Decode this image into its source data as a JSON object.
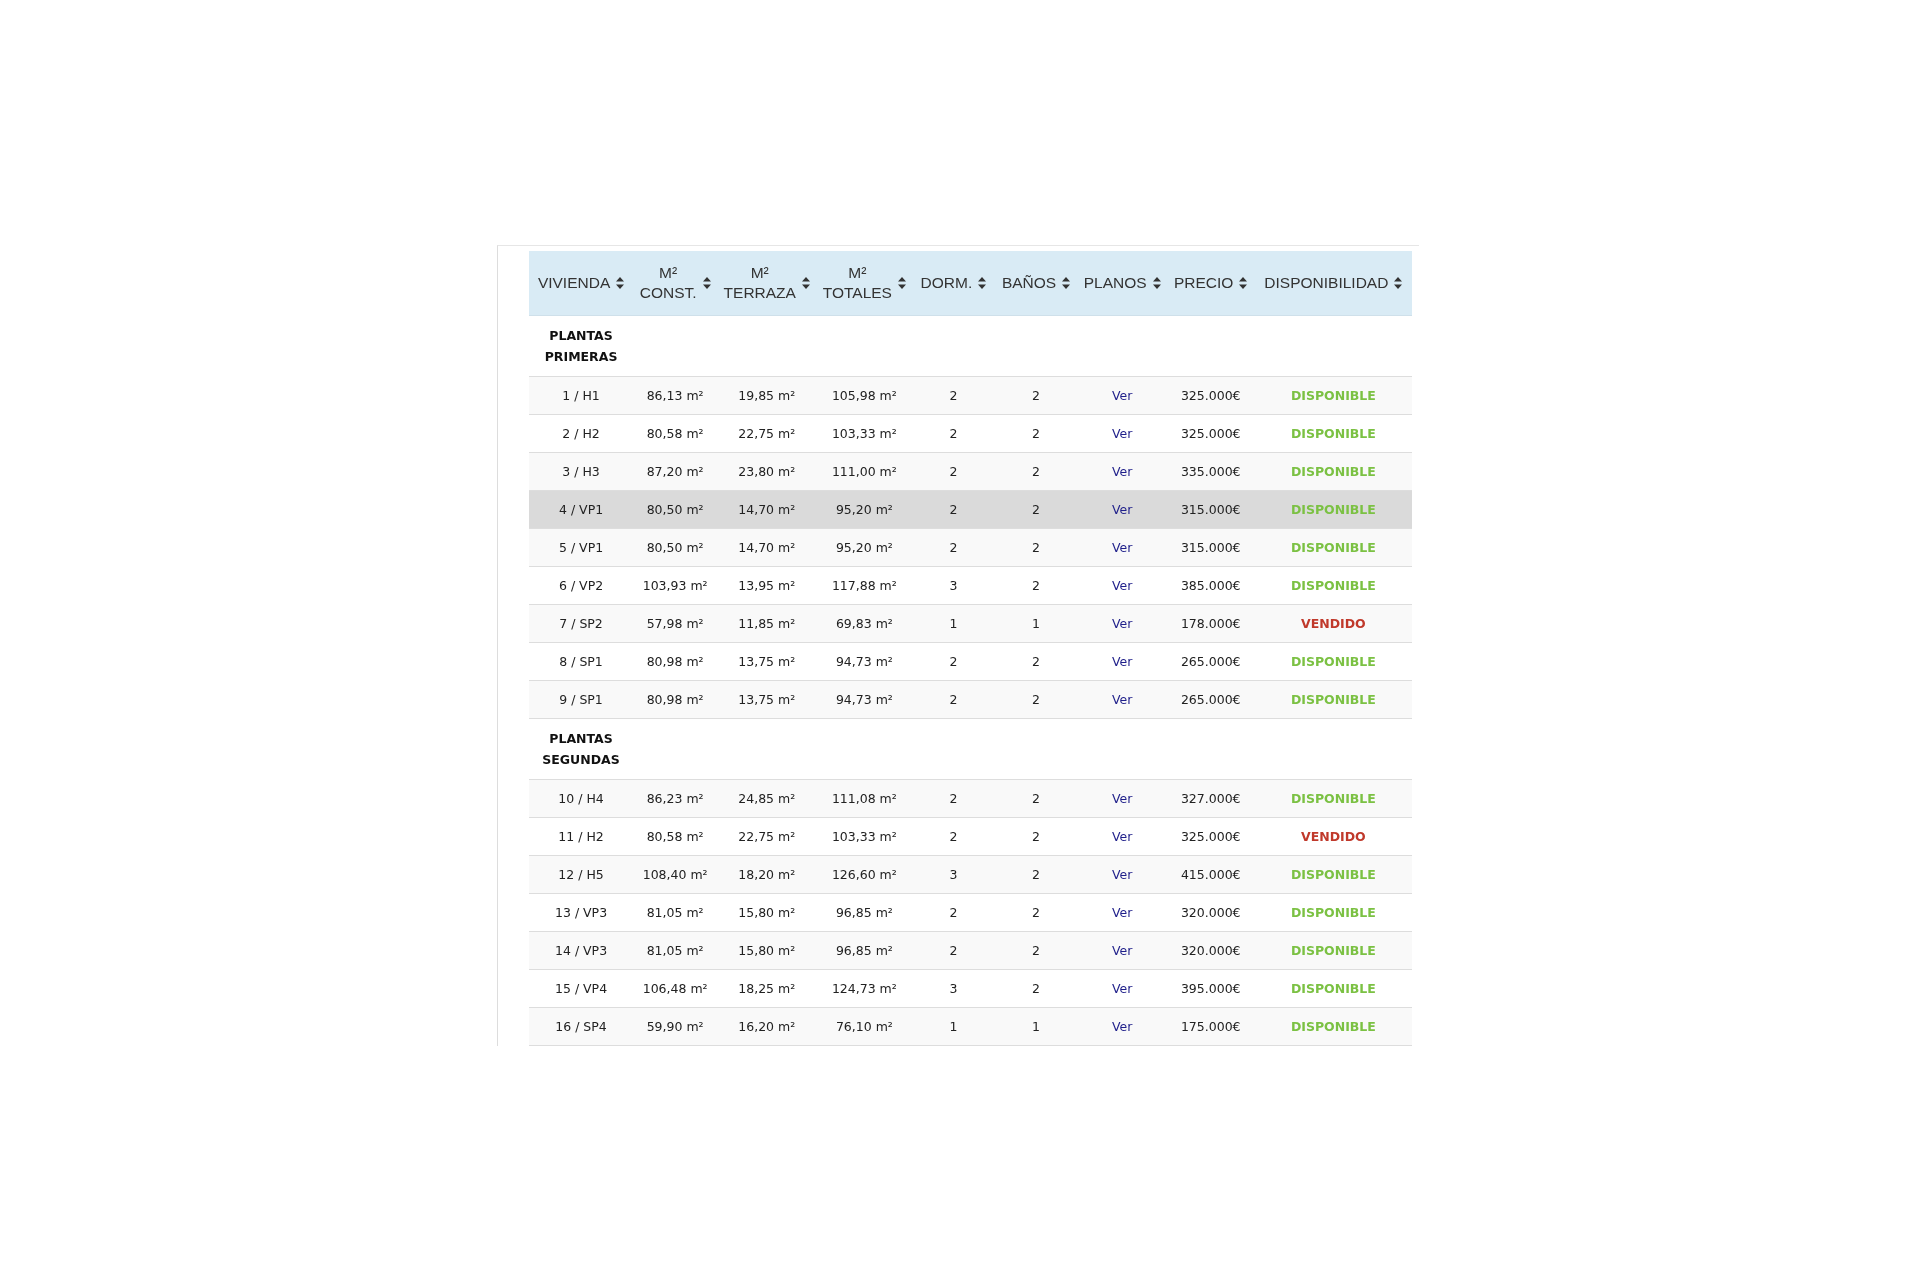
{
  "columns": [
    {
      "label": "VIVIENDA"
    },
    {
      "label": "M² CONST."
    },
    {
      "label": "M² TERRAZA"
    },
    {
      "label": "M² TOTALES"
    },
    {
      "label": "DORM."
    },
    {
      "label": "BAÑOS"
    },
    {
      "label": "PLANOS"
    },
    {
      "label": "PRECIO"
    },
    {
      "label": "DISPONIBILIDAD"
    }
  ],
  "sections": [
    {
      "title": "PLANTAS PRIMERAS",
      "rows": [
        {
          "vivienda": "1 / H1",
          "m2_const": "86,13 m²",
          "m2_terraza": "19,85 m²",
          "m2_totales": "105,98 m²",
          "dorm": "2",
          "banos": "2",
          "planos": "Ver",
          "precio": "325.000€",
          "status": "DISPONIBLE",
          "kind": "available",
          "hovered": false
        },
        {
          "vivienda": "2 / H2",
          "m2_const": "80,58 m²",
          "m2_terraza": "22,75 m²",
          "m2_totales": "103,33 m²",
          "dorm": "2",
          "banos": "2",
          "planos": "Ver",
          "precio": "325.000€",
          "status": "DISPONIBLE",
          "kind": "available",
          "hovered": false
        },
        {
          "vivienda": "3 / H3",
          "m2_const": "87,20 m²",
          "m2_terraza": "23,80 m²",
          "m2_totales": "111,00 m²",
          "dorm": "2",
          "banos": "2",
          "planos": "Ver",
          "precio": "335.000€",
          "status": "DISPONIBLE",
          "kind": "available",
          "hovered": false
        },
        {
          "vivienda": "4 / VP1",
          "m2_const": "80,50 m²",
          "m2_terraza": "14,70 m²",
          "m2_totales": "95,20 m²",
          "dorm": "2",
          "banos": "2",
          "planos": "Ver",
          "precio": "315.000€",
          "status": "DISPONIBLE",
          "kind": "available",
          "hovered": true
        },
        {
          "vivienda": "5 / VP1",
          "m2_const": "80,50 m²",
          "m2_terraza": "14,70 m²",
          "m2_totales": "95,20 m²",
          "dorm": "2",
          "banos": "2",
          "planos": "Ver",
          "precio": "315.000€",
          "status": "DISPONIBLE",
          "kind": "available",
          "hovered": false
        },
        {
          "vivienda": "6 / VP2",
          "m2_const": "103,93 m²",
          "m2_terraza": "13,95 m²",
          "m2_totales": "117,88 m²",
          "dorm": "3",
          "banos": "2",
          "planos": "Ver",
          "precio": "385.000€",
          "status": "DISPONIBLE",
          "kind": "available",
          "hovered": false
        },
        {
          "vivienda": "7 / SP2",
          "m2_const": "57,98 m²",
          "m2_terraza": "11,85 m²",
          "m2_totales": "69,83 m²",
          "dorm": "1",
          "banos": "1",
          "planos": "Ver",
          "precio": "178.000€",
          "status": "VENDIDO",
          "kind": "sold",
          "hovered": false
        },
        {
          "vivienda": "8 / SP1",
          "m2_const": "80,98 m²",
          "m2_terraza": "13,75 m²",
          "m2_totales": "94,73 m²",
          "dorm": "2",
          "banos": "2",
          "planos": "Ver",
          "precio": "265.000€",
          "status": "DISPONIBLE",
          "kind": "available",
          "hovered": false
        },
        {
          "vivienda": "9 / SP1",
          "m2_const": "80,98 m²",
          "m2_terraza": "13,75 m²",
          "m2_totales": "94,73 m²",
          "dorm": "2",
          "banos": "2",
          "planos": "Ver",
          "precio": "265.000€",
          "status": "DISPONIBLE",
          "kind": "available",
          "hovered": false
        }
      ]
    },
    {
      "title": "PLANTAS SEGUNDAS",
      "rows": [
        {
          "vivienda": "10 / H4",
          "m2_const": "86,23 m²",
          "m2_terraza": "24,85 m²",
          "m2_totales": "111,08 m²",
          "dorm": "2",
          "banos": "2",
          "planos": "Ver",
          "precio": "327.000€",
          "status": "DISPONIBLE",
          "kind": "available",
          "hovered": false
        },
        {
          "vivienda": "11 / H2",
          "m2_const": "80,58 m²",
          "m2_terraza": "22,75 m²",
          "m2_totales": "103,33 m²",
          "dorm": "2",
          "banos": "2",
          "planos": "Ver",
          "precio": "325.000€",
          "status": "VENDIDO",
          "kind": "sold",
          "hovered": false
        },
        {
          "vivienda": "12 / H5",
          "m2_const": "108,40 m²",
          "m2_terraza": "18,20 m²",
          "m2_totales": "126,60 m²",
          "dorm": "3",
          "banos": "2",
          "planos": "Ver",
          "precio": "415.000€",
          "status": "DISPONIBLE",
          "kind": "available",
          "hovered": false
        },
        {
          "vivienda": "13 / VP3",
          "m2_const": "81,05 m²",
          "m2_terraza": "15,80 m²",
          "m2_totales": "96,85 m²",
          "dorm": "2",
          "banos": "2",
          "planos": "Ver",
          "precio": "320.000€",
          "status": "DISPONIBLE",
          "kind": "available",
          "hovered": false
        },
        {
          "vivienda": "14 / VP3",
          "m2_const": "81,05 m²",
          "m2_terraza": "15,80 m²",
          "m2_totales": "96,85 m²",
          "dorm": "2",
          "banos": "2",
          "planos": "Ver",
          "precio": "320.000€",
          "status": "DISPONIBLE",
          "kind": "available",
          "hovered": false
        },
        {
          "vivienda": "15 / VP4",
          "m2_const": "106,48 m²",
          "m2_terraza": "18,25 m²",
          "m2_totales": "124,73 m²",
          "dorm": "3",
          "banos": "2",
          "planos": "Ver",
          "precio": "395.000€",
          "status": "DISPONIBLE",
          "kind": "available",
          "hovered": false
        },
        {
          "vivienda": "16 / SP4",
          "m2_const": "59,90 m²",
          "m2_terraza": "16,20 m²",
          "m2_totales": "76,10 m²",
          "dorm": "1",
          "banos": "1",
          "planos": "Ver",
          "precio": "175.000€",
          "status": "DISPONIBLE",
          "kind": "available",
          "hovered": false
        }
      ]
    }
  ]
}
